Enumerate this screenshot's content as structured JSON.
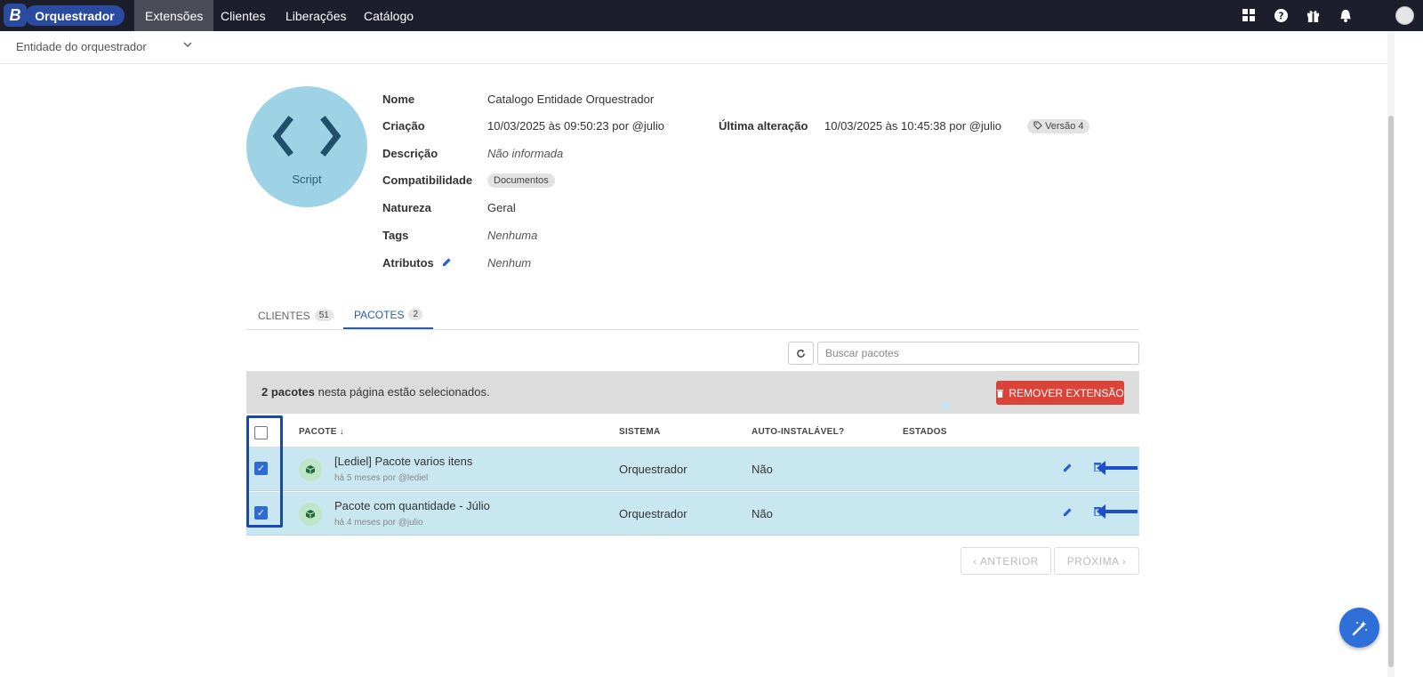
{
  "topbar": {
    "brand_letter": "B",
    "brand_name": "Orquestrador",
    "nav": [
      "Extensões",
      "Clientes",
      "Liberações",
      "Catálogo"
    ],
    "active_nav": "Extensões",
    "icons": [
      "grid-icon",
      "help-icon",
      "gift-icon",
      "bell-icon",
      "avatar"
    ]
  },
  "entity_selector": {
    "value": "Entidade do orquestrador"
  },
  "extension": {
    "type_label": "Script",
    "fields": {
      "nome_label": "Nome",
      "nome": "Catalogo Entidade Orquestrador",
      "criacao_label": "Criação",
      "criacao": "10/03/2025 às 09:50:23 por @julio",
      "ultima_alteracao_label": "Última alteração",
      "ultima_alteracao": "10/03/2025 às 10:45:38 por @julio",
      "versao": "Versão 4",
      "descricao_label": "Descrição",
      "descricao": "Não informada",
      "compatibilidade_label": "Compatibilidade",
      "compatibilidade": "Documentos",
      "natureza_label": "Natureza",
      "natureza": "Geral",
      "tags_label": "Tags",
      "tags": "Nenhuma",
      "atributos_label": "Atributos",
      "atributos": "Nenhum"
    }
  },
  "tabs": [
    {
      "label": "CLIENTES",
      "count": "51"
    },
    {
      "label": "PACOTES",
      "count": "2"
    }
  ],
  "search": {
    "placeholder": "Buscar pacotes"
  },
  "selection": {
    "count_bold": "2 pacotes",
    "text": " nesta página estão selecionados.",
    "remove_button": "REMOVER EXTENSÃO"
  },
  "table": {
    "headers": {
      "pacote": "PACOTE ↓",
      "sistema": "SISTEMA",
      "auto": "AUTO-INSTALÁVEL?",
      "estados": "ESTADOS"
    },
    "rows": [
      {
        "name": "[Lediel] Pacote varios itens",
        "meta": "há 5 meses por @lediel",
        "sistema": "Orquestrador",
        "auto": "Não"
      },
      {
        "name": "Pacote com quantidade - Júlio",
        "meta": "há 4 meses por @julio",
        "sistema": "Orquestrador",
        "auto": "Não"
      }
    ]
  },
  "pagination": {
    "prev": "‹  ANTERIOR",
    "next": "PRÓXIMA  ›"
  },
  "colors": {
    "topbar": "#1c1f2b",
    "brand": "#2b4ba0",
    "accent": "#2a5fa8",
    "danger": "#d9433a",
    "selected_row": "#c8e7f0"
  }
}
